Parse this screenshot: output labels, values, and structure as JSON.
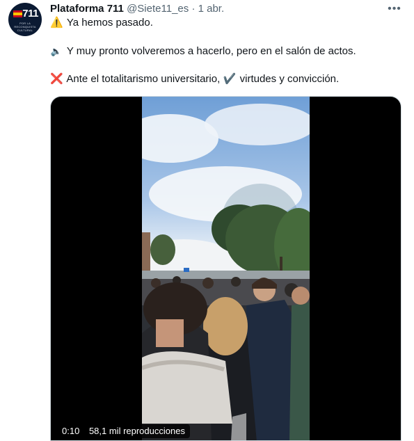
{
  "tweet": {
    "author_name": "Plataforma 711",
    "author_handle": "@Siete11_es",
    "separator": "·",
    "timestamp": "1 abr.",
    "more_icon": "more-horizontal-icon",
    "avatar": {
      "logo_text": "711",
      "logo_tagline": "POR LA RECONQUISTA CULTURAL",
      "flag_colors": [
        "#c60b1e",
        "#ffc400"
      ]
    },
    "lines": [
      {
        "emoji": "⚠️",
        "icon": "warning-icon",
        "text": "Ya hemos pasado."
      },
      {
        "emoji": "🔈",
        "icon": "speaker-icon",
        "text": "Y muy pronto volveremos a hacerlo, pero en el salón de actos."
      },
      {
        "emoji": "❌",
        "icon": "cross-mark-icon",
        "text": "Ante el totalitarismo universitario,",
        "emoji2": "✔️",
        "icon2": "check-mark-icon",
        "text2": "virtudes y convicción."
      }
    ],
    "video": {
      "duration": "0:10",
      "views": "58,1 mil reproducciones"
    }
  },
  "colors": {
    "text": "#0f1419",
    "secondary": "#536471",
    "border": "#cfd9de",
    "avatar_bg": "#0b1a33"
  }
}
